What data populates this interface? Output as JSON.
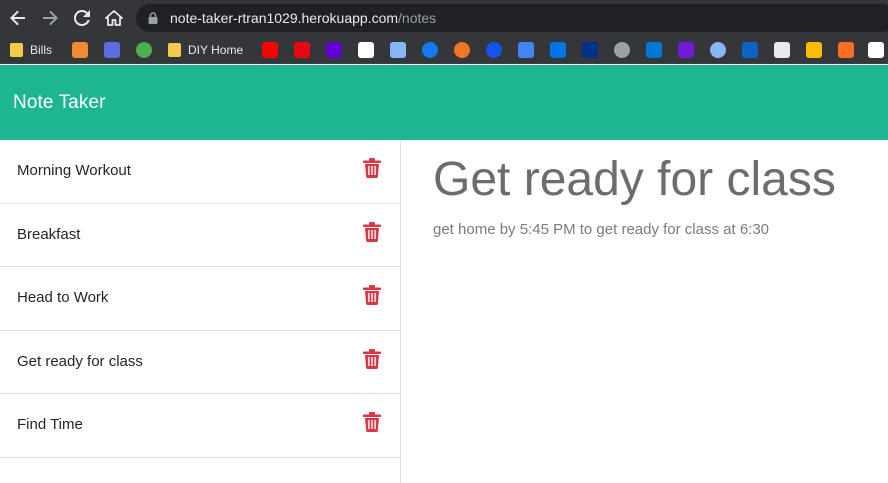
{
  "browser": {
    "url_host": "note-taker-rtran1029.herokuapp.com",
    "url_path": "/notes",
    "bookmarks": [
      {
        "label": "Bills",
        "icon": "folder-icon",
        "color": "#f4c94c"
      },
      {
        "label": "",
        "icon": "rainbow-icon",
        "color": "#f28b30"
      },
      {
        "label": "",
        "icon": "game-icon",
        "color": "#5b6ee1"
      },
      {
        "label": "",
        "icon": "tree-icon",
        "color": "#4caf50"
      },
      {
        "label": "DIY Home",
        "icon": "folder-icon",
        "color": "#f4c94c"
      },
      {
        "label": "",
        "icon": "youtube-icon",
        "color": "#ff0000"
      },
      {
        "label": "",
        "icon": "netflix-icon",
        "color": "#e50914"
      },
      {
        "label": "",
        "icon": "yahoo-icon",
        "color": "#6001d2"
      },
      {
        "label": "",
        "icon": "amazon-icon",
        "color": "#ffffff"
      },
      {
        "label": "",
        "icon": "flag-icon",
        "color": "#8ab4f8"
      },
      {
        "label": "",
        "icon": "facebook-icon",
        "color": "#1877f2"
      },
      {
        "label": "",
        "icon": "crunchyroll-icon",
        "color": "#f47521"
      },
      {
        "label": "",
        "icon": "coinbase-icon",
        "color": "#1652f0"
      },
      {
        "label": "",
        "icon": "squares-icon",
        "color": "#4285f4"
      },
      {
        "label": "",
        "icon": "zillow-icon",
        "color": "#0074e4"
      },
      {
        "label": "",
        "icon": "paypal-icon",
        "color": "#003087"
      },
      {
        "label": "",
        "icon": "globe-icon",
        "color": "#9aa0a6"
      },
      {
        "label": "",
        "icon": "outlook-icon",
        "color": "#0078d4"
      },
      {
        "label": "",
        "icon": "zelle-icon",
        "color": "#6d1ed4"
      },
      {
        "label": "",
        "icon": "chromecast-icon",
        "color": "#8ab4f8"
      },
      {
        "label": "",
        "icon": "linkedin-icon",
        "color": "#0a66c2"
      },
      {
        "label": "",
        "icon": "github-icon",
        "color": "#e8eaed"
      },
      {
        "label": "",
        "icon": "bee-icon",
        "color": "#fbbc04"
      },
      {
        "label": "",
        "icon": "gitlab-icon",
        "color": "#fc6d26"
      },
      {
        "label": "",
        "icon": "bookmark-icon",
        "color": "#ffffff"
      }
    ]
  },
  "app": {
    "title": "Note Taker",
    "accent": "#1eb592",
    "trash_color": "#dc3545"
  },
  "notes": [
    {
      "title": "Morning Workout"
    },
    {
      "title": "Breakfast"
    },
    {
      "title": "Head to Work"
    },
    {
      "title": "Get ready for class"
    },
    {
      "title": "Find Time"
    }
  ],
  "active_note": {
    "title": "Get ready for class",
    "text": "get home by 5:45 PM to get ready for class at 6:30"
  }
}
